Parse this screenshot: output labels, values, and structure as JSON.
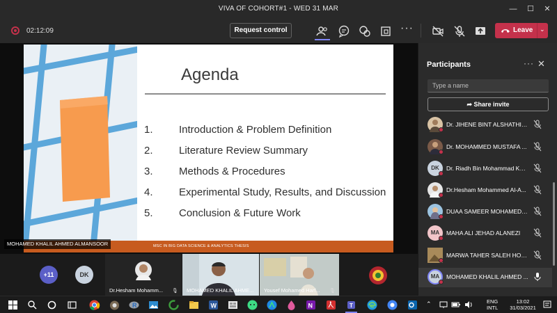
{
  "window": {
    "title": "VIVA OF COHORT#1 - WED 31 MAR"
  },
  "toolbar": {
    "timer": "02:12:09",
    "request_control_label": "Request control",
    "leave_label": "Leave",
    "icons": [
      "participants-icon",
      "chat-icon",
      "reactions-icon",
      "rooms-icon",
      "more-icon",
      "camera-off-icon",
      "mic-off-icon",
      "share-icon"
    ]
  },
  "slide": {
    "title": "Agenda",
    "items": [
      {
        "num": "1.",
        "text": "Introduction & Problem Definition"
      },
      {
        "num": "2.",
        "text": "Literature Review Summary"
      },
      {
        "num": "3.",
        "text": "Methods & Procedures"
      },
      {
        "num": "4.",
        "text": "Experimental Study, Results, and Discussion"
      },
      {
        "num": "5.",
        "text": "Conclusion & Future Work"
      }
    ],
    "footer": "MSC IN BIG DATA SCIENCE & ANALYTICS THESIS"
  },
  "presenter_label": "MOHAMED KHALIL AHMED ALMANSOOR",
  "strip": {
    "overflow_count": "+11",
    "initials_tile": "DK",
    "tiles": [
      {
        "name": "Dr.Hesham Mohamm..."
      },
      {
        "name": "MOHAMED KHALIL AHME..."
      },
      {
        "name": "Yousef Mohamed Harf..."
      }
    ]
  },
  "panel": {
    "title": "Participants",
    "search_placeholder": "Type a name",
    "share_invite": "Share invite",
    "participants": [
      {
        "name": "Dr. JIHENE BINT ALSHATHIY K...",
        "initials": "",
        "avatar_color": "#d9c3a5"
      },
      {
        "name": "Dr. MOHAMMED MUSTAFA ...",
        "initials": "",
        "avatar_color": "#7a5a48"
      },
      {
        "name": "Dr. Riadh Bin Mohammad Ksa...",
        "initials": "DK",
        "avatar_color": "#c9d3df"
      },
      {
        "name": "Dr.Hesham Mohammed Al-A...",
        "initials": "",
        "avatar_color": "#b58d6a"
      },
      {
        "name": "DUAA SAMEER MOHAMED A...",
        "initials": "",
        "avatar_color": "#9cc3e0"
      },
      {
        "name": "MAHA ALI JEHAD ALANEZI",
        "initials": "MA",
        "avatar_color": "#f2c5c9"
      },
      {
        "name": "MARWA TAHER SALEH HOME...",
        "initials": "",
        "avatar_color": "#a88a5a"
      },
      {
        "name": "MOHAMED KHALIL AHMED ...",
        "initials": "MA",
        "avatar_color": "#c9d3df"
      }
    ]
  },
  "taskbar": {
    "lang_top": "ENG",
    "lang_bottom": "INTL",
    "time": "13:02",
    "date": "31/03/2021"
  }
}
